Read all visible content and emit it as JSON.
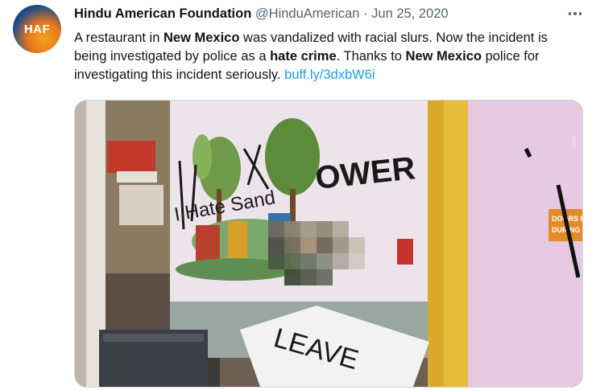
{
  "tweet": {
    "avatar_text": "HAF",
    "display_name": "Hindu American Foundation",
    "handle": "@HinduAmerican",
    "separator": "·",
    "date": "Jun 25, 2020",
    "text_parts": [
      "A restaurant in ",
      "New Mexico",
      " was vandalized with racial slurs. Now the incident is being investigated by police as a ",
      "hate crime",
      ". Thanks to ",
      "New Mexico",
      " police for investigating this incident seriously. "
    ],
    "link": "buff.ly/3dxbW6i"
  },
  "media": {
    "graffiti_top": "OWER",
    "graffiti_mid": "I Hate Sand",
    "graffiti_table": "LEAVE",
    "sign_text": [
      "DOORS REM",
      "DURING BUS"
    ],
    "door_graffiti": "Di",
    "watermark": "CNN"
  },
  "colors": {
    "link": "#1d9bf0",
    "muted": "#536471"
  }
}
